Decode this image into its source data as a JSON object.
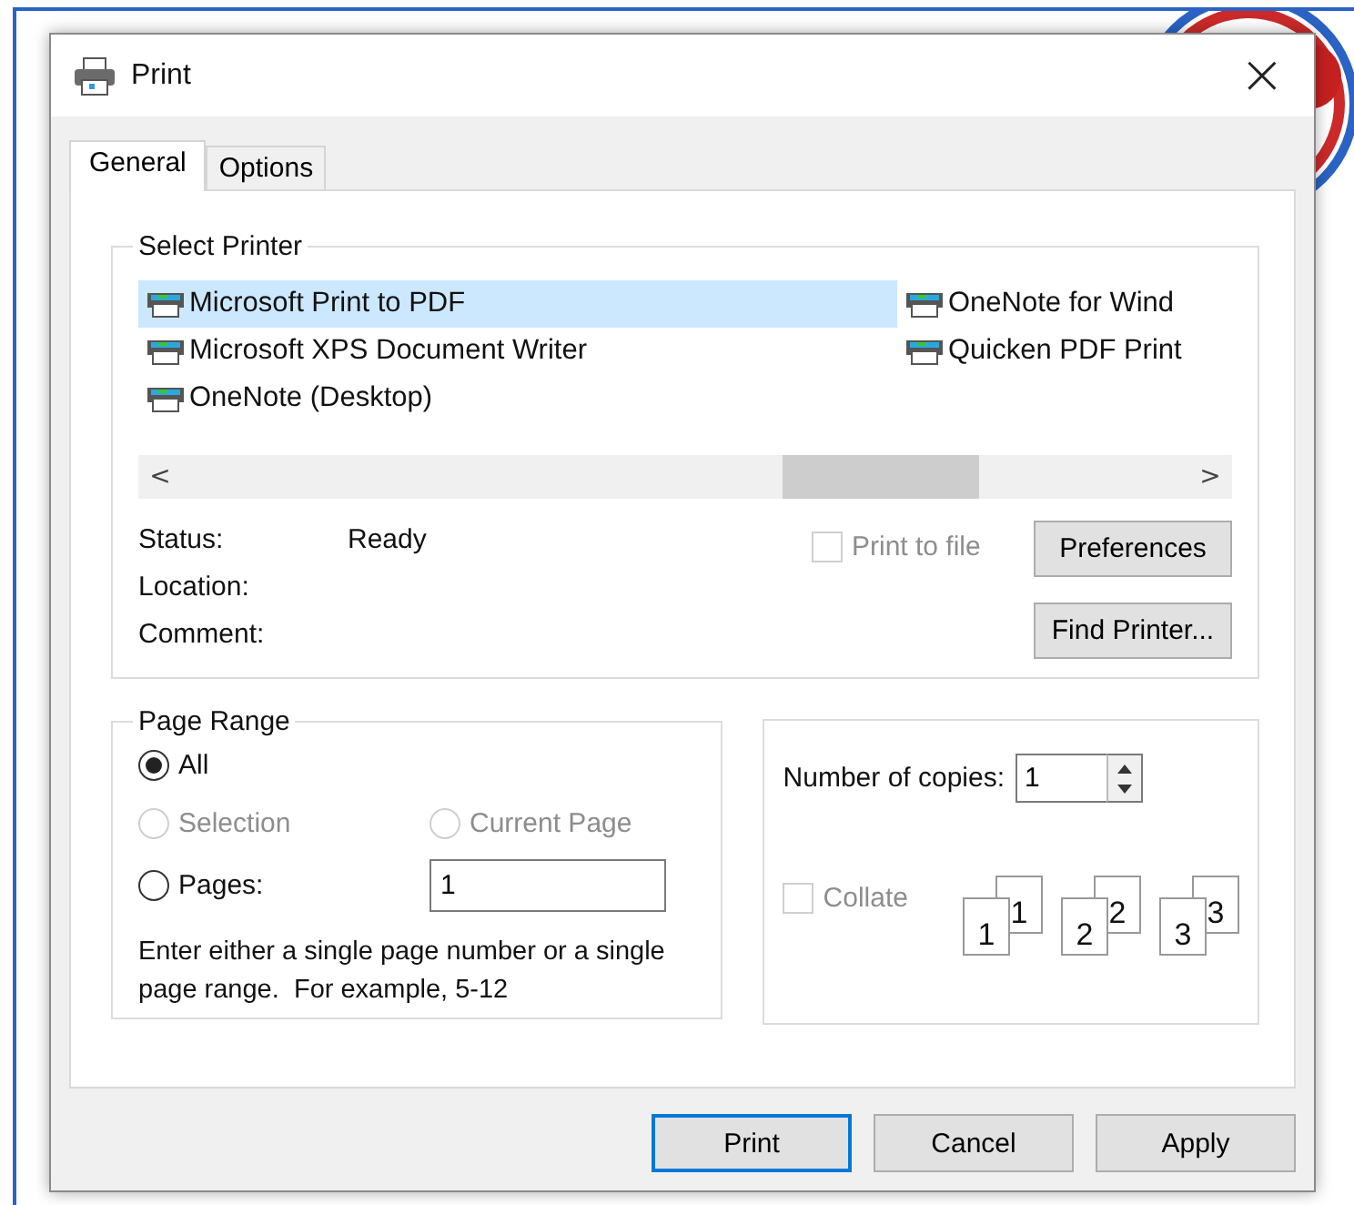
{
  "window": {
    "title": "Print",
    "close": "×"
  },
  "tabs": [
    {
      "label": "General",
      "selected": true
    },
    {
      "label": "Options",
      "selected": false
    }
  ],
  "select_printer": {
    "label": "Select Printer",
    "printers": [
      {
        "name": "Microsoft Print to PDF",
        "selected": true
      },
      {
        "name": "Microsoft XPS Document Writer",
        "selected": false
      },
      {
        "name": "OneNote (Desktop)",
        "selected": false
      },
      {
        "name": "OneNote for Wind",
        "selected": false
      },
      {
        "name": "Quicken PDF Print",
        "selected": false
      }
    ],
    "scroll_left": "<",
    "scroll_right": ">",
    "info": [
      {
        "label": "Status:",
        "value": "Ready"
      },
      {
        "label": "Location:"
      },
      {
        "label": "Comment:"
      }
    ],
    "print_to_file": {
      "label": "Print to file",
      "checked": false,
      "disabled": true
    },
    "preferences": "Preferences",
    "find_printer": "Find Printer..."
  },
  "page_range": {
    "label": "Page Range",
    "options": [
      {
        "label": "All",
        "selected": true,
        "disabled": false
      },
      {
        "label": "Selection",
        "selected": false,
        "disabled": true
      },
      {
        "label": "Current Page",
        "selected": false,
        "disabled": true
      },
      {
        "label": "Pages:",
        "selected": false,
        "disabled": false
      }
    ],
    "pages_value": "1",
    "hint": "Enter either a single page number or a single page range.  For example, 5-12"
  },
  "copies": {
    "label": "Number of copies:",
    "value": "1",
    "collate": {
      "label": "Collate",
      "checked": false,
      "disabled": true
    },
    "collate_pages": [
      {
        "front": "1",
        "back": "1"
      },
      {
        "front": "2",
        "back": "2"
      },
      {
        "front": "3",
        "back": "3"
      }
    ]
  },
  "buttons": [
    {
      "label": "Print",
      "default": true
    },
    {
      "label": "Cancel",
      "default": false
    },
    {
      "label": "Apply",
      "default": false
    }
  ]
}
